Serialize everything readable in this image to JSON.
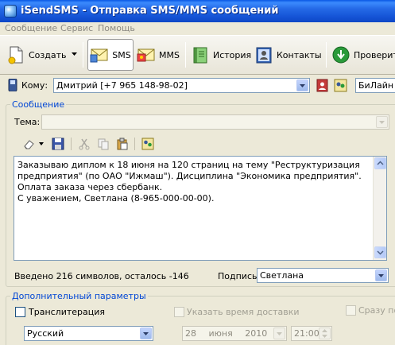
{
  "window": {
    "title": "iSendSMS - Отправка SMS/MMS сообщений"
  },
  "menu": {
    "items": [
      "Сообщение",
      "Сервис",
      "Помощь"
    ]
  },
  "toolbar": {
    "create_label": "Создать",
    "sms_label": "SMS",
    "mms_label": "MMS",
    "history_label": "История",
    "contacts_label": "Контакты",
    "check_label": "Проверит"
  },
  "recipient": {
    "label": "Кому:",
    "value": "Дмитрий [+7 965 148-98-02]",
    "operator": "БиЛайн"
  },
  "message": {
    "group_title": "Сообщение",
    "subject_label": "Тема:",
    "subject_value": "",
    "body": "Заказываю диплом к 18 июня на 120 страниц на тему \"Реструктуризация предприятия\" (по ОАО \"Ижмаш\"). Дисциплина \"Экономика предприятия\". Оплата заказа через сбербанк.\nС уважением, Светлана (8-965-000-00-00).",
    "counter": "Введено 216 символов, осталось -146",
    "signature_label": "Подпись",
    "signature_value": "Светлана"
  },
  "options": {
    "group_title": "Дополнительный параметры",
    "transliteration_label": "Транслитерация",
    "transliteration_checked": false,
    "delivery_time_label": "Указать время доставки",
    "immediately_label": "Сразу пок",
    "language": "Русский",
    "date": {
      "day": "28",
      "month": "июня",
      "year": "2010"
    },
    "time": "21:00"
  },
  "colors": {
    "title_bar": "#0A58E4",
    "group_title": "#0046D5",
    "window_bg": "#ECE9D8"
  }
}
